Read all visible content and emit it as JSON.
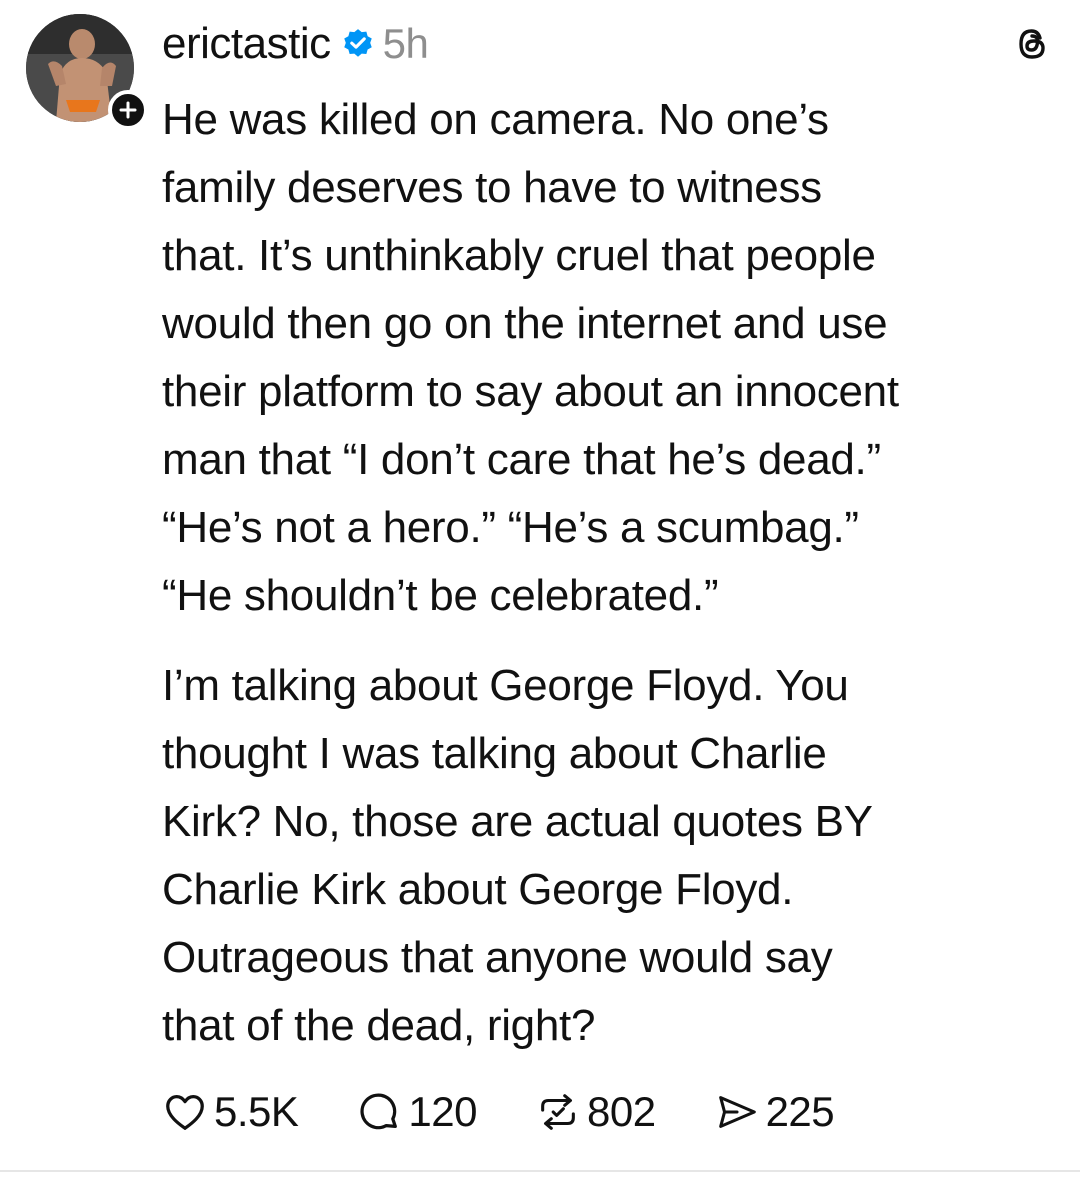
{
  "post": {
    "author": {
      "username": "erictastic",
      "verified": true,
      "avatar_icon": "profile-photo-icon",
      "follow_icon": "plus-icon"
    },
    "timestamp": "5h",
    "app_icon": "threads-logo-icon",
    "paragraphs": [
      "He was killed on camera. No one’s\nfamily deserves to have to witness\nthat. It’s unthinkably cruel that people\nwould then go on the internet and use\ntheir platform to say about an innocent\nman that “I don’t care that he’s dead.”\n“He’s not a hero.” “He’s a scumbag.”\n“He shouldn’t be celebrated.”",
      "I’m talking about George Floyd. You\nthought I was talking about Charlie\nKirk? No, those are actual quotes BY\nCharlie Kirk about George Floyd.\nOutrageous that anyone would say\nthat of the dead, right?"
    ],
    "actions": {
      "likes": "5.5K",
      "replies": "120",
      "reposts": "802",
      "shares": "225"
    }
  },
  "colors": {
    "text": "#111111",
    "muted": "#8e8e8e",
    "verified_blue": "#0095f6",
    "divider": "#e6e6e6"
  }
}
